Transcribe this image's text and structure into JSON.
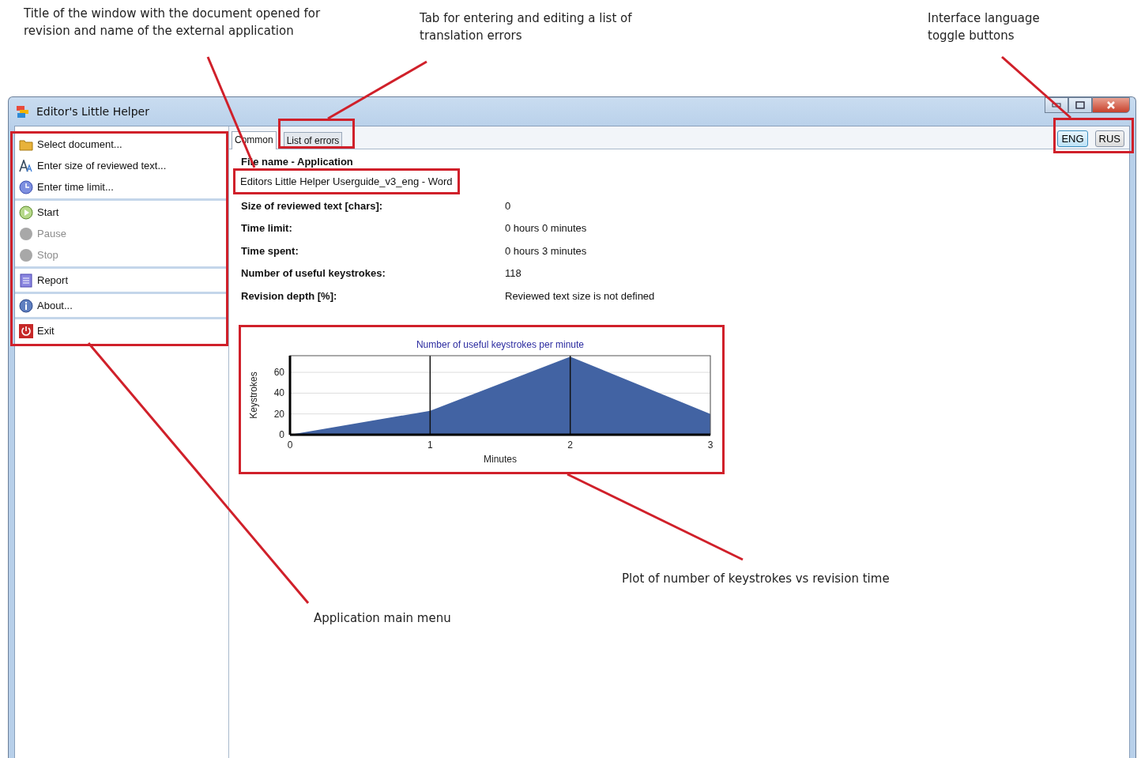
{
  "annotations": [
    {
      "text": "Title of the window with the document opened for revision and name of the external application"
    },
    {
      "text": "Tab for entering and editing a list of translation errors"
    },
    {
      "text": "Interface language toggle buttons"
    },
    {
      "text": "Plot of number of keystrokes vs revision time"
    },
    {
      "text": "Application main menu"
    }
  ],
  "window": {
    "title": "Editor's Little Helper"
  },
  "tabs": [
    {
      "label": "Common",
      "selected": true
    },
    {
      "label": "List of errors",
      "selected": false
    }
  ],
  "language_buttons": [
    {
      "label": "ENG",
      "selected": true
    },
    {
      "label": "RUS",
      "selected": false
    }
  ],
  "menu": [
    [
      {
        "kind": "folder",
        "label": "Select document...",
        "disabled": false
      },
      {
        "kind": "font",
        "label": "Enter size of reviewed text...",
        "disabled": false
      },
      {
        "kind": "clock",
        "label": "Enter time limit...",
        "disabled": false
      }
    ],
    [
      {
        "kind": "play",
        "label": "Start",
        "disabled": false
      },
      {
        "kind": "circle",
        "label": "Pause",
        "disabled": true
      },
      {
        "kind": "circle",
        "label": "Stop",
        "disabled": true
      }
    ],
    [
      {
        "kind": "report",
        "label": "Report",
        "disabled": false
      }
    ],
    [
      {
        "kind": "info",
        "label": "About...",
        "disabled": false
      }
    ],
    [
      {
        "kind": "power",
        "label": "Exit",
        "disabled": false
      }
    ]
  ],
  "file_name": {
    "label": "File name - Application",
    "value": "Editors Little Helper Userguide_v3_eng - Word"
  },
  "fields": [
    {
      "label": "Size of reviewed text [chars]:",
      "value": "0"
    },
    {
      "label": "Time limit:",
      "value": "0 hours 0 minutes"
    },
    {
      "label": "Time spent:",
      "value": "0 hours 3 minutes"
    },
    {
      "label": "Number of useful keystrokes:",
      "value": "118"
    },
    {
      "label": "Revision depth [%]:",
      "value": "Reviewed text size is not defined"
    }
  ],
  "chart": {
    "chart_data": {
      "type": "area",
      "title": "Number of useful keystrokes per minute",
      "xlabel": "Minutes",
      "ylabel": "Keystrokes",
      "x": [
        0,
        1,
        2,
        3
      ],
      "grid": true,
      "series": [
        {
          "color": "#4263a3",
          "values": [
            0,
            23,
            75,
            20
          ]
        }
      ],
      "xlim": [
        0,
        3
      ],
      "ylim": [
        0,
        76
      ],
      "xticks": [
        0,
        1,
        2,
        3
      ],
      "yticks": [
        0,
        20,
        40,
        60
      ]
    }
  }
}
